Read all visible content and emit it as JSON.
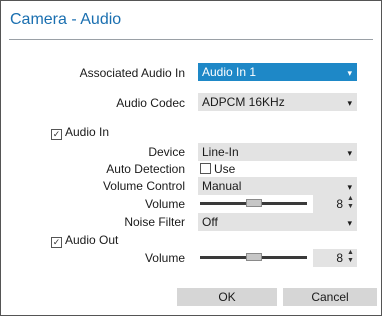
{
  "dialog": {
    "title": "Camera - Audio"
  },
  "associated_audio_in": {
    "label": "Associated Audio In",
    "value": "Audio In 1"
  },
  "audio_codec": {
    "label": "Audio Codec",
    "value": "ADPCM 16KHz"
  },
  "audio_in": {
    "checkbox_label": "Audio In",
    "checked": true,
    "device": {
      "label": "Device",
      "value": "Line-In"
    },
    "auto_detection": {
      "label": "Auto Detection",
      "checkbox_label": "Use",
      "checked": false
    },
    "volume_control": {
      "label": "Volume Control",
      "value": "Manual"
    },
    "volume": {
      "label": "Volume",
      "value": "8",
      "slider_fraction": 0.5
    },
    "noise_filter": {
      "label": "Noise Filter",
      "value": "Off"
    }
  },
  "audio_out": {
    "checkbox_label": "Audio Out",
    "checked": true,
    "volume": {
      "label": "Volume",
      "value": "8",
      "slider_fraction": 0.5
    }
  },
  "buttons": {
    "ok": "OK",
    "cancel": "Cancel"
  },
  "icons": {
    "dropdown": "chevron-down-icon",
    "check": "checkmark-icon",
    "spin": "spin-arrows-icon"
  },
  "colors": {
    "title": "#1a6fb0",
    "active_combo": "#1e88c7",
    "combo": "#e3e3e3",
    "button": "#d6d6d6"
  }
}
